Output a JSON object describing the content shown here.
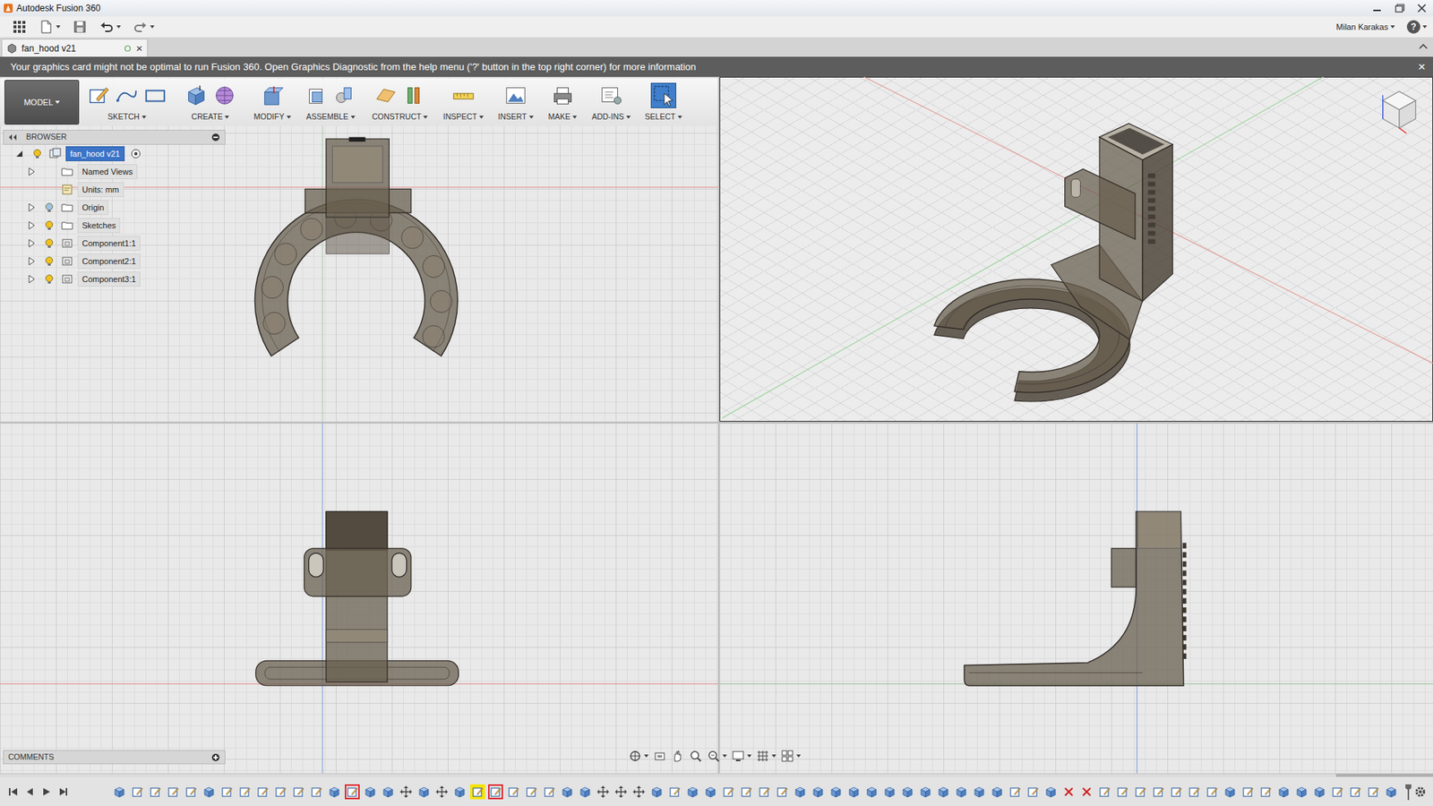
{
  "window": {
    "title": "Autodesk Fusion 360"
  },
  "user": {
    "name": "Milan Karakas"
  },
  "help": {
    "label": "?"
  },
  "document_tabs": [
    {
      "label": "fan_hood v21",
      "close": "×",
      "selected": true
    }
  ],
  "notification": {
    "text": "Your graphics card might not be optimal to run Fusion 360. Open Graphics Diagnostic from the help menu ('?' button in the top right corner) for more information",
    "close": "×"
  },
  "workspace": {
    "label": "MODEL"
  },
  "ribbon": [
    {
      "label": "SKETCH",
      "selected": false
    },
    {
      "label": "CREATE",
      "selected": false
    },
    {
      "label": "MODIFY",
      "selected": false
    },
    {
      "label": "ASSEMBLE",
      "selected": false
    },
    {
      "label": "CONSTRUCT",
      "selected": false
    },
    {
      "label": "INSPECT",
      "selected": false
    },
    {
      "label": "INSERT",
      "selected": false
    },
    {
      "label": "MAKE",
      "selected": false
    },
    {
      "label": "ADD-INS",
      "selected": false
    },
    {
      "label": "SELECT",
      "selected": true
    }
  ],
  "browser": {
    "title": "BROWSER",
    "items": [
      {
        "label": "fan_hood v21",
        "kind": "root",
        "expandable": true,
        "expanded": true,
        "has_light": true,
        "light": true,
        "selected": true
      },
      {
        "label": "Named Views",
        "kind": "folder",
        "expandable": true,
        "expanded": false,
        "has_light": false,
        "light": false,
        "selected": false
      },
      {
        "label": "Units: mm",
        "kind": "units",
        "expandable": false,
        "expanded": false,
        "has_light": false,
        "light": false,
        "selected": false
      },
      {
        "label": "Origin",
        "kind": "folder",
        "expandable": true,
        "expanded": false,
        "has_light": true,
        "light": false,
        "selected": false
      },
      {
        "label": "Sketches",
        "kind": "folder",
        "expandable": true,
        "expanded": false,
        "has_light": true,
        "light": true,
        "selected": false
      },
      {
        "label": "Component1:1",
        "kind": "component",
        "expandable": true,
        "expanded": false,
        "has_light": true,
        "light": true,
        "selected": false
      },
      {
        "label": "Component2:1",
        "kind": "component",
        "expandable": true,
        "expanded": false,
        "has_light": true,
        "light": true,
        "selected": false
      },
      {
        "label": "Component3:1",
        "kind": "component",
        "expandable": true,
        "expanded": false,
        "has_light": true,
        "light": true,
        "selected": false
      }
    ]
  },
  "comments": {
    "title": "COMMENTS"
  },
  "timeline": {
    "features": [
      {
        "kind": "extrude",
        "flag": "none"
      },
      {
        "kind": "sketch",
        "flag": "none"
      },
      {
        "kind": "sketch",
        "flag": "none"
      },
      {
        "kind": "sketch",
        "flag": "none"
      },
      {
        "kind": "sketch",
        "flag": "none"
      },
      {
        "kind": "extrude",
        "flag": "none"
      },
      {
        "kind": "sketch",
        "flag": "none"
      },
      {
        "kind": "sketch",
        "flag": "none"
      },
      {
        "kind": "sketch",
        "flag": "none"
      },
      {
        "kind": "sketch",
        "flag": "none"
      },
      {
        "kind": "sketch",
        "flag": "none"
      },
      {
        "kind": "sketch",
        "flag": "none"
      },
      {
        "kind": "extrude",
        "flag": "none"
      },
      {
        "kind": "sketch",
        "flag": "error"
      },
      {
        "kind": "extrude",
        "flag": "none"
      },
      {
        "kind": "extrude",
        "flag": "none"
      },
      {
        "kind": "move",
        "flag": "none"
      },
      {
        "kind": "extrude",
        "flag": "none"
      },
      {
        "kind": "move",
        "flag": "none"
      },
      {
        "kind": "extrude",
        "flag": "none"
      },
      {
        "kind": "sketch",
        "flag": "warning"
      },
      {
        "kind": "sketch",
        "flag": "error"
      },
      {
        "kind": "sketch",
        "flag": "none"
      },
      {
        "kind": "sketch",
        "flag": "none"
      },
      {
        "kind": "sketch",
        "flag": "none"
      },
      {
        "kind": "extrude",
        "flag": "none"
      },
      {
        "kind": "extrude",
        "flag": "none"
      },
      {
        "kind": "move",
        "flag": "none"
      },
      {
        "kind": "move",
        "flag": "none"
      },
      {
        "kind": "move",
        "flag": "none"
      },
      {
        "kind": "extrude",
        "flag": "none"
      },
      {
        "kind": "sketch",
        "flag": "none"
      },
      {
        "kind": "extrude",
        "flag": "none"
      },
      {
        "kind": "extrude",
        "flag": "none"
      },
      {
        "kind": "sketch",
        "flag": "none"
      },
      {
        "kind": "sketch",
        "flag": "none"
      },
      {
        "kind": "sketch",
        "flag": "none"
      },
      {
        "kind": "sketch",
        "flag": "none"
      },
      {
        "kind": "extrude",
        "flag": "none"
      },
      {
        "kind": "extrude",
        "flag": "none"
      },
      {
        "kind": "extrude",
        "flag": "none"
      },
      {
        "kind": "extrude",
        "flag": "none"
      },
      {
        "kind": "extrude",
        "flag": "none"
      },
      {
        "kind": "extrude",
        "flag": "none"
      },
      {
        "kind": "extrude",
        "flag": "none"
      },
      {
        "kind": "extrude",
        "flag": "none"
      },
      {
        "kind": "extrude",
        "flag": "none"
      },
      {
        "kind": "extrude",
        "flag": "none"
      },
      {
        "kind": "extrude",
        "flag": "none"
      },
      {
        "kind": "extrude",
        "flag": "none"
      },
      {
        "kind": "sketch",
        "flag": "none"
      },
      {
        "kind": "sketch",
        "flag": "none"
      },
      {
        "kind": "extrude",
        "flag": "none"
      },
      {
        "kind": "extrude",
        "flag": "removed"
      },
      {
        "kind": "extrude",
        "flag": "removed"
      },
      {
        "kind": "sketch",
        "flag": "none"
      },
      {
        "kind": "sketch",
        "flag": "none"
      },
      {
        "kind": "sketch",
        "flag": "none"
      },
      {
        "kind": "sketch",
        "flag": "none"
      },
      {
        "kind": "sketch",
        "flag": "none"
      },
      {
        "kind": "sketch",
        "flag": "none"
      },
      {
        "kind": "sketch",
        "flag": "none"
      },
      {
        "kind": "extrude",
        "flag": "none"
      },
      {
        "kind": "sketch",
        "flag": "none"
      },
      {
        "kind": "sketch",
        "flag": "none"
      },
      {
        "kind": "extrude",
        "flag": "none"
      },
      {
        "kind": "extrude",
        "flag": "none"
      },
      {
        "kind": "extrude",
        "flag": "none"
      },
      {
        "kind": "sketch",
        "flag": "none"
      },
      {
        "kind": "sketch",
        "flag": "none"
      },
      {
        "kind": "sketch",
        "flag": "none"
      },
      {
        "kind": "extrude",
        "flag": "none"
      }
    ]
  }
}
